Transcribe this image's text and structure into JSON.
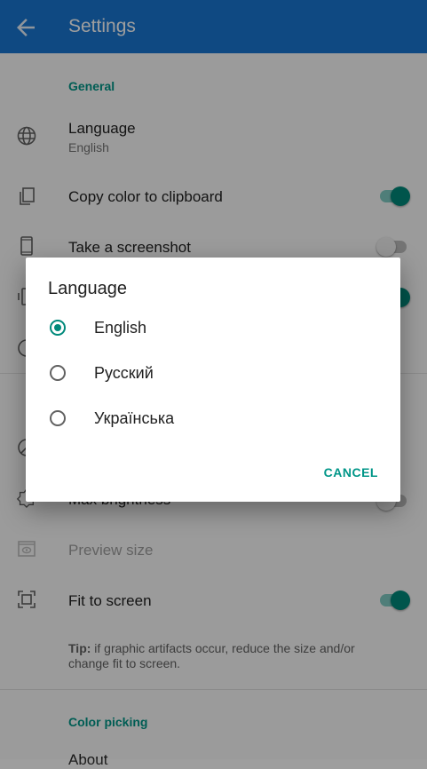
{
  "appbar": {
    "title": "Settings"
  },
  "sections": {
    "general": "General",
    "color_picking": "Color picking"
  },
  "rows": {
    "language": {
      "title": "Language",
      "subtitle": "English"
    },
    "copy_color": {
      "title": "Copy color to clipboard",
      "enabled": true
    },
    "screenshot": {
      "title": "Take a screenshot",
      "enabled": false
    },
    "max_brightness": {
      "title": "Max brightness"
    },
    "preview_size": {
      "title": "Preview size"
    },
    "fit_to_screen": {
      "title": "Fit to screen",
      "enabled": true
    },
    "about": {
      "title": "About"
    }
  },
  "tip": {
    "label": "Tip:",
    "text": " if graphic artifacts occur, reduce the size and/or change fit to screen."
  },
  "dialog": {
    "title": "Language",
    "options": [
      {
        "label": "English",
        "selected": true
      },
      {
        "label": "Русский",
        "selected": false
      },
      {
        "label": "Українська",
        "selected": false
      }
    ],
    "cancel": "CANCEL"
  },
  "colors": {
    "primary": "#1976d2",
    "accent": "#009688"
  }
}
